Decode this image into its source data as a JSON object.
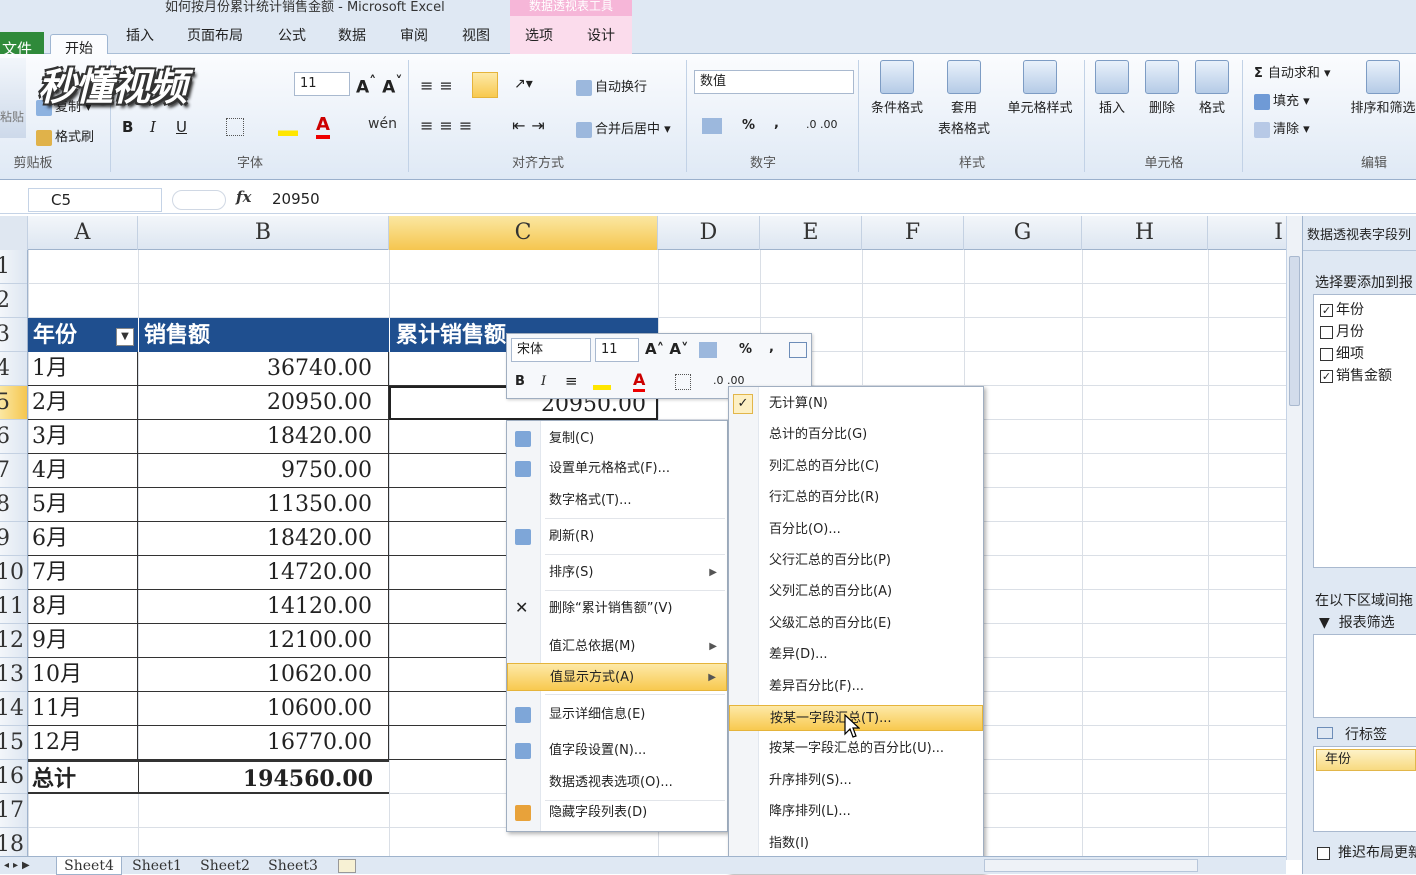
{
  "window": {
    "title": "如何按月份累计统计销售金额 - Microsoft Excel",
    "context_tab": "数据透视表工具"
  },
  "tabs": [
    {
      "label": "文件"
    },
    {
      "label": "开始"
    },
    {
      "label": "插入"
    },
    {
      "label": "页面布局"
    },
    {
      "label": "公式"
    },
    {
      "label": "数据"
    },
    {
      "label": "审阅"
    },
    {
      "label": "视图"
    },
    {
      "label": "选项"
    },
    {
      "label": "设计"
    }
  ],
  "watermark": "秒懂视频",
  "ribbon": {
    "clipboard": {
      "paste": "粘贴",
      "copy": "复制",
      "format_painter": "格式刷",
      "label": "剪贴板"
    },
    "font": {
      "size": "11",
      "label": "字体",
      "bold": "B",
      "italic": "I",
      "underline": "U"
    },
    "alignment": {
      "wrap": "自动换行",
      "merge": "合并后居中",
      "label": "对齐方式"
    },
    "number": {
      "format": "数值",
      "label": "数字",
      "percent": "%",
      "comma": ","
    },
    "styles": {
      "conditional": "条件格式",
      "table_1": "套用",
      "table_2": "表格格式",
      "cell_styles": "单元格样式",
      "label": "样式"
    },
    "cells": {
      "insert": "插入",
      "delete": "删除",
      "format": "格式",
      "label": "单元格"
    },
    "editing": {
      "autosum": "自动求和",
      "fill": "填充",
      "clear": "清除",
      "sort": "排序和筛选",
      "label": "编辑"
    }
  },
  "formula_bar": {
    "name_box": "C5",
    "fx": "fx",
    "value": "20950"
  },
  "columns": [
    "A",
    "B",
    "C",
    "D",
    "E",
    "F",
    "G",
    "H",
    "I"
  ],
  "rows": [
    "1",
    "2",
    "3",
    "4",
    "5",
    "6",
    "7",
    "8",
    "9",
    "10",
    "11",
    "12",
    "13",
    "14",
    "15",
    "16",
    "17",
    "18"
  ],
  "table": {
    "headers": {
      "year": "年份",
      "sales": "销售额",
      "cumulative": "累计销售额"
    },
    "data": [
      {
        "month": "1月",
        "sales": "36740.00",
        "cum": ""
      },
      {
        "month": "2月",
        "sales": "20950.00",
        "cum": "20950.00"
      },
      {
        "month": "3月",
        "sales": "18420.00",
        "cum": ""
      },
      {
        "month": "4月",
        "sales": "9750.00",
        "cum": ""
      },
      {
        "month": "5月",
        "sales": "11350.00",
        "cum": ""
      },
      {
        "month": "6月",
        "sales": "18420.00",
        "cum": ""
      },
      {
        "month": "7月",
        "sales": "14720.00",
        "cum": ""
      },
      {
        "month": "8月",
        "sales": "14120.00",
        "cum": ""
      },
      {
        "month": "9月",
        "sales": "12100.00",
        "cum": ""
      },
      {
        "month": "10月",
        "sales": "10620.00",
        "cum": ""
      },
      {
        "month": "11月",
        "sales": "10600.00",
        "cum": ""
      },
      {
        "month": "12月",
        "sales": "16770.00",
        "cum": ""
      }
    ],
    "total": {
      "label": "总计",
      "sales": "194560.00"
    }
  },
  "mini_toolbar": {
    "font": "宋体",
    "size": "11",
    "bold": "B",
    "italic": "I",
    "percent": "%",
    "comma": ","
  },
  "context_menu": [
    {
      "label": "复制(C)"
    },
    {
      "label": "设置单元格格式(F)..."
    },
    {
      "label": "数字格式(T)..."
    },
    {
      "label": "刷新(R)"
    },
    {
      "label": "排序(S)"
    },
    {
      "label": "删除“累计销售额”(V)"
    },
    {
      "label": "值汇总依据(M)"
    },
    {
      "label": "值显示方式(A)"
    },
    {
      "label": "显示详细信息(E)"
    },
    {
      "label": "值字段设置(N)..."
    },
    {
      "label": "数据透视表选项(O)..."
    },
    {
      "label": "隐藏字段列表(D)"
    }
  ],
  "submenu": [
    {
      "label": "无计算(N)"
    },
    {
      "label": "总计的百分比(G)"
    },
    {
      "label": "列汇总的百分比(C)"
    },
    {
      "label": "行汇总的百分比(R)"
    },
    {
      "label": "百分比(O)..."
    },
    {
      "label": "父行汇总的百分比(P)"
    },
    {
      "label": "父列汇总的百分比(A)"
    },
    {
      "label": "父级汇总的百分比(E)"
    },
    {
      "label": "差异(D)..."
    },
    {
      "label": "差异百分比(F)..."
    },
    {
      "label": "按某一字段汇总(T)..."
    },
    {
      "label": "按某一字段汇总的百分比(U)..."
    },
    {
      "label": "升序排列(S)..."
    },
    {
      "label": "降序排列(L)..."
    },
    {
      "label": "指数(I)"
    }
  ],
  "pivot_panel": {
    "title": "数据透视表字段列",
    "choose_label": "选择要添加到报",
    "fields": [
      {
        "label": "年份",
        "checked": true
      },
      {
        "label": "月份",
        "checked": false
      },
      {
        "label": "细项",
        "checked": false
      },
      {
        "label": "销售金额",
        "checked": true
      }
    ],
    "drag_label": "在以下区域间拖",
    "report_filter": "报表筛选",
    "row_labels": "行标签",
    "row_item": "年份",
    "defer": "推迟布局更新"
  },
  "sheets": [
    "Sheet4",
    "Sheet1",
    "Sheet2",
    "Sheet3"
  ]
}
